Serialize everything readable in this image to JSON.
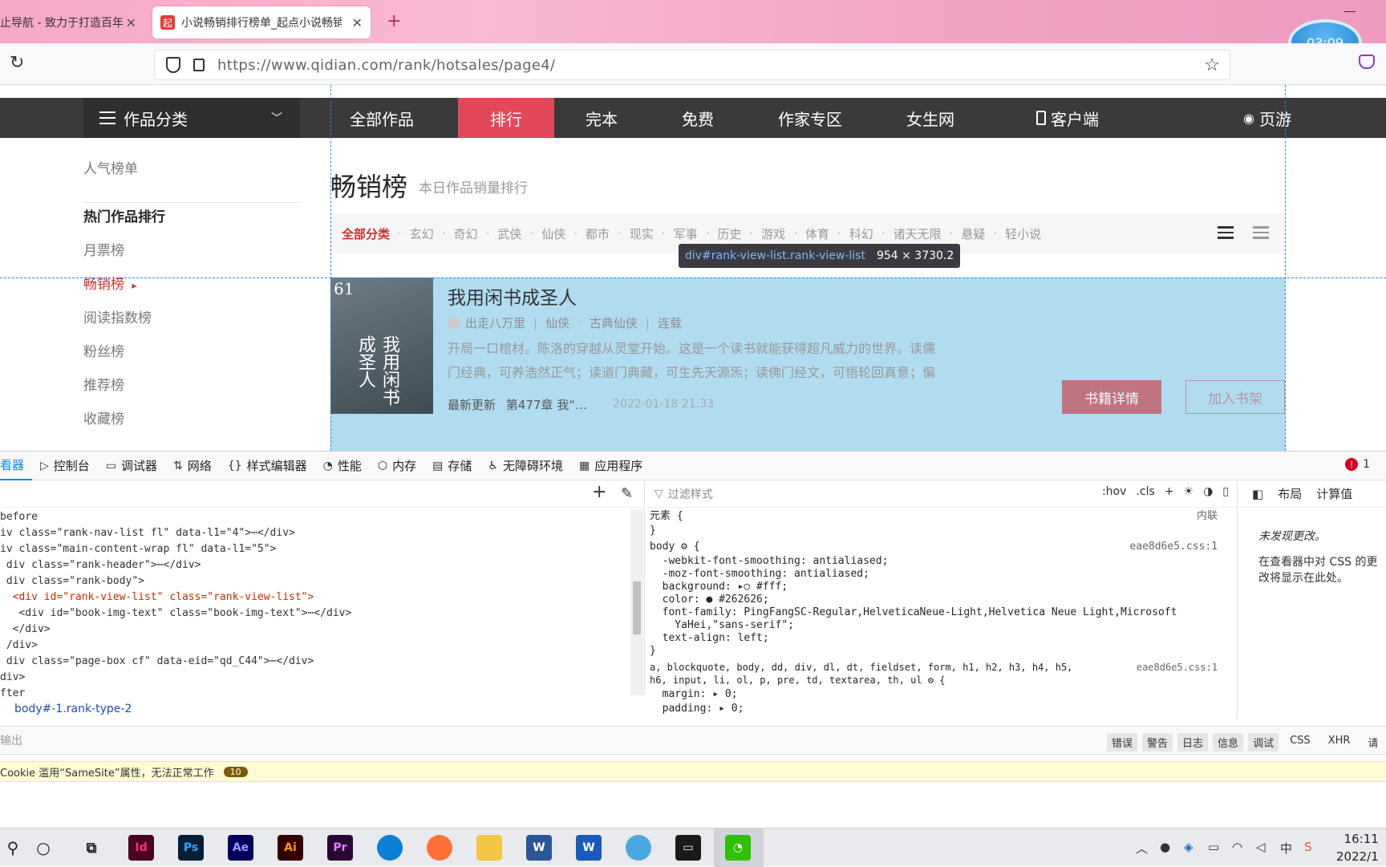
{
  "browser": {
    "tabs": [
      {
        "label": "止导航 - 致力于打造百年",
        "active": false
      },
      {
        "label": "小说畅销排行榜单_起点小说畅销",
        "active": true
      }
    ],
    "new_tab": "+",
    "url": "https://www.qidian.com/rank/hotsales/page4/",
    "timer": "03:09",
    "favicon_text": "起"
  },
  "site": {
    "category_button": "作品分类",
    "nav": [
      {
        "label": "全部作品"
      },
      {
        "label": "排行",
        "active": true
      },
      {
        "label": "完本"
      },
      {
        "label": "免费"
      },
      {
        "label": "作家专区"
      },
      {
        "label": "女生网"
      },
      {
        "label": "客户端"
      },
      {
        "label": "页游"
      }
    ],
    "left_nav": [
      {
        "label": "人气榜单"
      },
      {
        "label": "热门作品排行",
        "bold": true
      },
      {
        "label": "月票榜"
      },
      {
        "label": "畅销榜",
        "active": true,
        "arrow": "▸"
      },
      {
        "label": "阅读指数榜"
      },
      {
        "label": "粉丝榜"
      },
      {
        "label": "推荐榜"
      },
      {
        "label": "收藏榜"
      }
    ],
    "rank_title": "畅销榜",
    "rank_subtitle": "本日作品销量排行",
    "filters": [
      "全部分类",
      "玄幻",
      "奇幻",
      "武侠",
      "仙侠",
      "都市",
      "现实",
      "军事",
      "历史",
      "游戏",
      "体育",
      "科幻",
      "诸天无限",
      "悬疑",
      "轻小说"
    ],
    "filter_sep": "·",
    "tooltip": {
      "selector": "div#rank-view-list.rank-view-list",
      "size": "954 × 3730.2"
    },
    "book": {
      "rank": "61",
      "title": "我用闲书成圣人",
      "cover_title": "我用闲书成圣人",
      "author": "出走八万里",
      "genre": "仙侠",
      "subgenre": "古典仙侠",
      "status": "连载",
      "desc_line1": "开局一口棺材。陈洛的穿越从灵堂开始。这是一个读书就能获得超凡威力的世界。读儒",
      "desc_line2": "门经典，可养浩然正气；读道门典藏，可生先天源炁；读佛门经文，可悟轮回真意；偏",
      "update_label": "最新更新",
      "update_chapter": "第477章  我“…",
      "update_time": "2022-01-18 21:33",
      "detail_button": "书籍详情",
      "shelf_button": "加入书架"
    }
  },
  "devtools": {
    "tabs": [
      {
        "label": "看器",
        "icon": "inspector-icon",
        "active": true
      },
      {
        "label": "控制台",
        "icon": "console-icon"
      },
      {
        "label": "调试器",
        "icon": "debugger-icon"
      },
      {
        "label": "网络",
        "icon": "network-icon"
      },
      {
        "label": "样式编辑器",
        "icon": "style-editor-icon"
      },
      {
        "label": "性能",
        "icon": "performance-icon"
      },
      {
        "label": "内存",
        "icon": "memory-icon"
      },
      {
        "label": "存储",
        "icon": "storage-icon"
      },
      {
        "label": "无障碍环境",
        "icon": "accessibility-icon"
      },
      {
        "label": "应用程序",
        "icon": "application-icon"
      }
    ],
    "error_count": "1",
    "markup": [
      "before",
      "iv class=\"rank-nav-list fl\" data-l1=\"4\">⋯</div>",
      "iv class=\"main-content-wrap fl\" data-l1=\"5\">",
      " div class=\"rank-header\">⋯</div>",
      " div class=\"rank-body\">",
      "  <div id=\"rank-view-list\" class=\"rank-view-list\">",
      "   <div id=\"book-img-text\" class=\"book-img-text\">⋯</div>",
      "  </div>",
      " /div>",
      " div class=\"page-box cf\" data-eid=\"qd_C44\">⋯</div>",
      "div>",
      "fter"
    ],
    "breadcrumb": "body#-1.rank-type-2",
    "rules_filter_placeholder": "过滤样式",
    "rules_tools": [
      ":hov",
      ".cls",
      "+"
    ],
    "rules": [
      {
        "text": "元素 {",
        "source": "内联"
      },
      {
        "text": "}"
      },
      {
        "text": "body ⚙ {",
        "source": "eae8d6e5.css:1"
      },
      {
        "text": "  -webkit-font-smoothing: antialiased;",
        "strike": true
      },
      {
        "text": "  -moz-font-smoothing: antialiased;",
        "strike": true
      },
      {
        "text": "  background: ▸○ #fff;"
      },
      {
        "text": "  color: ● #262626;"
      },
      {
        "text": "  font-family: PingFangSC-Regular,HelveticaNeue-Light,Helvetica Neue Light,Microsoft"
      },
      {
        "text": "    YaHei,\"sans-serif\";"
      },
      {
        "text": "  text-align: left;"
      },
      {
        "text": "}"
      },
      {
        "text": "a, blockquote, body, dd, div, dl, dt, fieldset, form, h1, h2, h3, h4, h5,",
        "source": "eae8d6e5.css:1"
      },
      {
        "text": "h6, input, li, ol, p, pre, td, textarea, th, ul ⚙ {"
      },
      {
        "text": "  margin: ▸ 0;"
      },
      {
        "text": "  padding: ▸ 0;"
      }
    ],
    "side_tabs": [
      "布局",
      "计算值"
    ],
    "side_note1": "未发现更改。",
    "side_note2": "在查看器中对 CSS 的更改将显示在此处。",
    "console_placeholder": "输出",
    "console_filters": [
      "错误",
      "警告",
      "日志",
      "信息",
      "调试",
      "CSS",
      "XHR",
      "请"
    ],
    "console_message": "Cookie 滥用“SameSite”属性，无法正常工作",
    "console_message_count": "10"
  },
  "taskbar": {
    "apps": [
      {
        "icon": "search-icon",
        "label": ""
      },
      {
        "icon": "cortana-icon",
        "label": ""
      },
      {
        "icon": "task-view-icon",
        "label": ""
      },
      {
        "icon": "indesign-icon",
        "label": "Id",
        "color": "#49021f"
      },
      {
        "icon": "photoshop-icon",
        "label": "Ps",
        "color": "#001e36"
      },
      {
        "icon": "after-effects-icon",
        "label": "Ae",
        "color": "#00005b"
      },
      {
        "icon": "illustrator-icon",
        "label": "Ai",
        "color": "#330000"
      },
      {
        "icon": "premiere-icon",
        "label": "Pr",
        "color": "#2a0634"
      },
      {
        "icon": "edge-icon",
        "label": "",
        "color": "#0c7fd6"
      },
      {
        "icon": "firefox-icon",
        "label": "",
        "color": "#ff7139"
      },
      {
        "icon": "file-explorer-icon",
        "label": "",
        "color": "#f4c542"
      },
      {
        "icon": "word-icon",
        "label": "W",
        "color": "#2b579a"
      },
      {
        "icon": "word-icon",
        "label": "W",
        "color": "#185abd"
      },
      {
        "icon": "app-icon",
        "label": "",
        "color": "#4aa8e0"
      },
      {
        "icon": "terminal-icon",
        "label": "",
        "color": "#1a1a1a"
      },
      {
        "icon": "wechat-icon",
        "label": "",
        "color": "#2dc100"
      }
    ],
    "time": "16:11",
    "date": "2022/1"
  }
}
